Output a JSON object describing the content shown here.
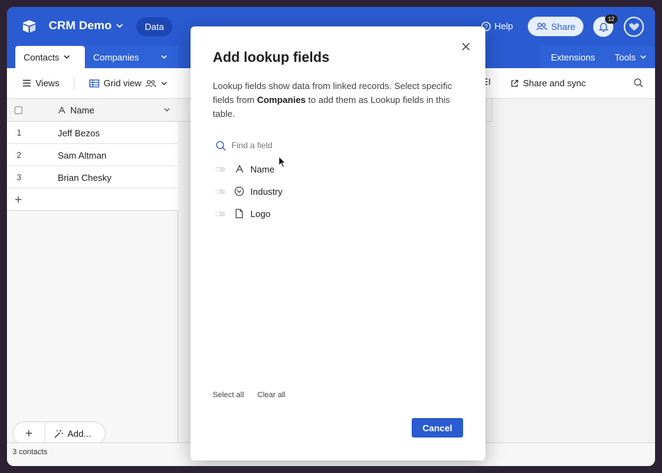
{
  "app": {
    "title": "CRM Demo",
    "section_pill": "Data",
    "help_label": "Help",
    "share_label": "Share",
    "notification_count": "12"
  },
  "tabs": {
    "active": "Contacts",
    "second": "Companies",
    "extensions": "Extensions",
    "tools": "Tools"
  },
  "toolbar": {
    "views_label": "Views",
    "grid_view_label": "Grid view",
    "share_sync_label": "Share and sync"
  },
  "grid": {
    "column_header": "Name",
    "rows": [
      {
        "num": "1",
        "name": "Jeff Bezos"
      },
      {
        "num": "2",
        "name": "Sam Altman"
      },
      {
        "num": "3",
        "name": "Brian Chesky"
      }
    ],
    "footer_count": "3 contacts",
    "add_label": "Add..."
  },
  "modal": {
    "title": "Add lookup fields",
    "desc_before": "Lookup fields show data from linked records. Select specific fields from ",
    "desc_bold": "Companies",
    "desc_after": " to add them as Lookup fields in this table.",
    "search_placeholder": "Find a field",
    "fields": [
      {
        "label": "Name",
        "icon": "text-a-icon",
        "enabled": false
      },
      {
        "label": "Industry",
        "icon": "single-select-icon",
        "enabled": false
      },
      {
        "label": "Logo",
        "icon": "attachment-file-icon",
        "enabled": false
      }
    ],
    "select_all": "Select all",
    "clear_all": "Clear all",
    "cancel": "Cancel"
  },
  "colors": {
    "brand_blue": "#2a5bd1",
    "header_dark_blue": "#1d47b3"
  }
}
